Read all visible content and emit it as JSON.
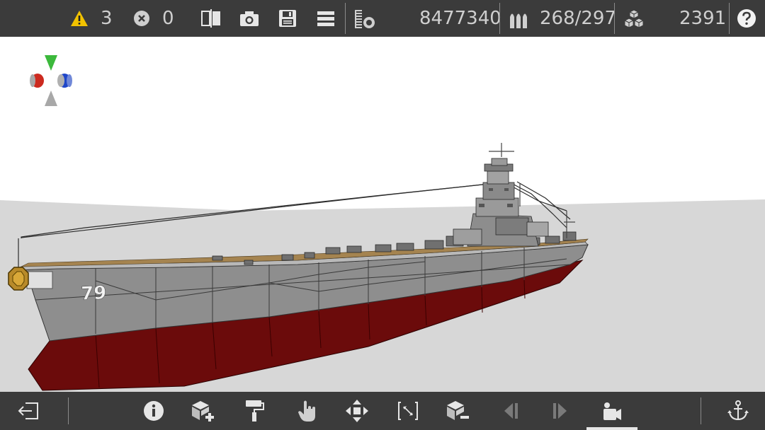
{
  "toolbar": {
    "warnings": "3",
    "errors": "0",
    "weight": "8477340",
    "ammo": "268/297",
    "blocks": "2391"
  },
  "model": {
    "hull_number": "79"
  },
  "bottom": {
    "active_tool": "camera-view"
  },
  "colors": {
    "bar": "#3b3b3b",
    "warning": "#f2c200",
    "hull": "#8a8a8a",
    "hull_lower": "#6b0b0b",
    "floor": "#d7d7d7",
    "sky": "#ffffff"
  }
}
